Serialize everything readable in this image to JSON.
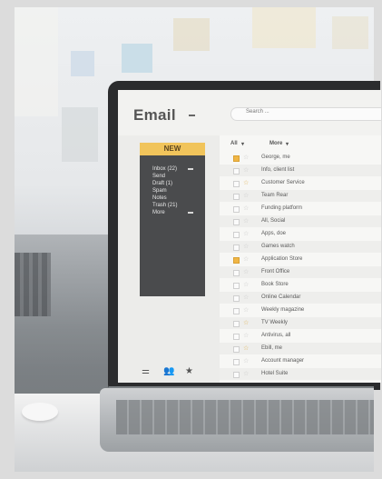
{
  "app": {
    "title": "Email"
  },
  "search": {
    "placeholder": "Search ..."
  },
  "sidebar": {
    "new_label": "NEW",
    "items": [
      {
        "label": "Inbox (22)"
      },
      {
        "label": "Send"
      },
      {
        "label": "Draft (1)"
      },
      {
        "label": "Spam"
      },
      {
        "label": "Notes"
      },
      {
        "label": "Trash (21)"
      },
      {
        "label": "More"
      }
    ],
    "bottom_icons": [
      "settings-sliders-icon",
      "contacts-icon",
      "favorites-star-icon"
    ]
  },
  "list": {
    "filter_all": "All",
    "filter_more": "More",
    "rows": [
      {
        "sender": "George, me",
        "checked": true,
        "starred": false
      },
      {
        "sender": "Info, client list",
        "checked": false,
        "starred": false
      },
      {
        "sender": "Customer Service",
        "checked": false,
        "starred": true
      },
      {
        "sender": "Team Rear",
        "checked": false,
        "starred": false
      },
      {
        "sender": "Funding platform",
        "checked": false,
        "starred": false
      },
      {
        "sender": "All, Social",
        "checked": false,
        "starred": false
      },
      {
        "sender": "Apps, doe",
        "checked": false,
        "starred": false
      },
      {
        "sender": "Games watch",
        "checked": false,
        "starred": false
      },
      {
        "sender": "Application Store",
        "checked": true,
        "starred": false
      },
      {
        "sender": "Front Office",
        "checked": false,
        "starred": false
      },
      {
        "sender": "Book Store",
        "checked": false,
        "starred": false
      },
      {
        "sender": "Online Calendar",
        "checked": false,
        "starred": false
      },
      {
        "sender": "Weekly magazine",
        "checked": false,
        "starred": false
      },
      {
        "sender": "TV Weekly",
        "checked": false,
        "starred": true
      },
      {
        "sender": "Antivirus, all",
        "checked": false,
        "starred": false
      },
      {
        "sender": "Ebill, me",
        "checked": false,
        "starred": true
      },
      {
        "sender": "Account manager",
        "checked": false,
        "starred": false
      },
      {
        "sender": "Hotel Suite",
        "checked": false,
        "starred": false
      }
    ]
  },
  "colors": {
    "accent": "#f1c45b",
    "sidebar_bg": "#4a4b4d"
  }
}
